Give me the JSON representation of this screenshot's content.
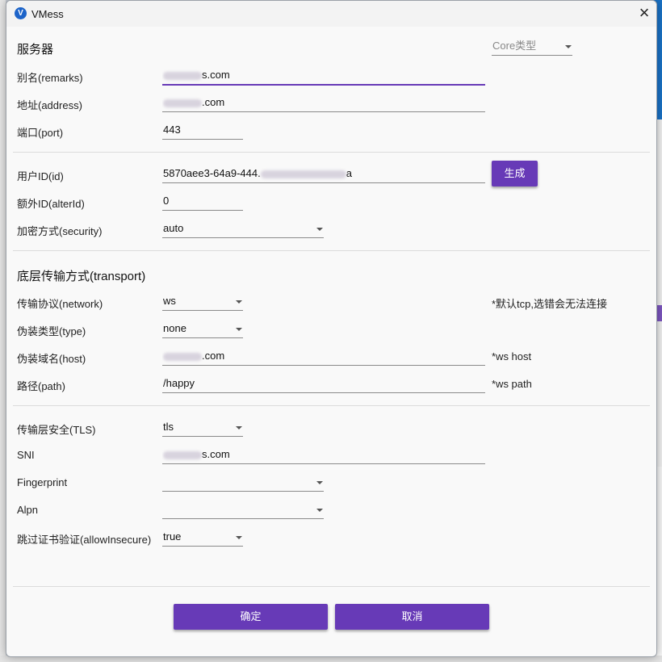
{
  "window": {
    "title": "VMess",
    "icon": "v2rayn-logo-icon",
    "close": "×"
  },
  "server": {
    "heading": "服务器",
    "core_type": {
      "placeholder": "Core类型",
      "value": ""
    },
    "remarks": {
      "label": "别名(remarks)",
      "value": "s.com"
    },
    "address": {
      "label": "地址(address)",
      "value": ".com"
    },
    "port": {
      "label": "端口(port)",
      "value": "443"
    }
  },
  "user": {
    "id": {
      "label": "用户ID(id)",
      "value": "5870aee3-64a9-444.",
      "tail": "a"
    },
    "generate_button": "生成",
    "alter_id": {
      "label": "额外ID(alterId)",
      "value": "0"
    },
    "security": {
      "label": "加密方式(security)",
      "value": "auto"
    }
  },
  "transport": {
    "heading": "底层传输方式(transport)",
    "network": {
      "label": "传输协议(network)",
      "value": "ws",
      "note": "*默认tcp,选错会无法连接"
    },
    "type": {
      "label": "伪装类型(type)",
      "value": "none"
    },
    "host": {
      "label": "伪装域名(host)",
      "value": ".com",
      "note": "*ws host"
    },
    "path": {
      "label": "路径(path)",
      "value": "/happy",
      "note": "*ws path"
    }
  },
  "tls": {
    "tls": {
      "label": "传输层安全(TLS)",
      "value": "tls"
    },
    "sni": {
      "label": "SNI",
      "value": "s.com"
    },
    "fingerprint": {
      "label": "Fingerprint",
      "value": ""
    },
    "alpn": {
      "label": "Alpn",
      "value": ""
    },
    "allow_insecure": {
      "label": "跳过证书验证(allowInsecure)",
      "value": "true"
    }
  },
  "footer": {
    "ok": "确定",
    "cancel": "取消"
  },
  "colors": {
    "accent": "#673ab7",
    "app_blue": "#1a73c8"
  }
}
